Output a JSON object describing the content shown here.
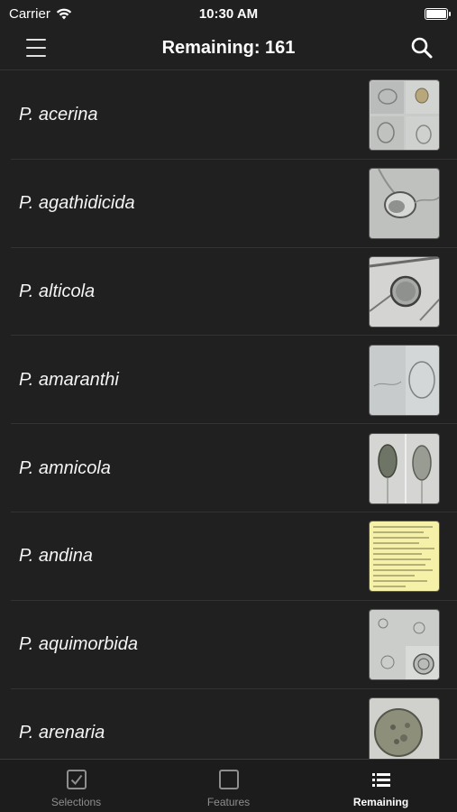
{
  "status_bar": {
    "carrier": "Carrier",
    "time": "10:30 AM"
  },
  "nav": {
    "title": "Remaining: 161"
  },
  "species": [
    {
      "label": "P. acerina"
    },
    {
      "label": "P. agathidicida"
    },
    {
      "label": "P. alticola"
    },
    {
      "label": "P. amaranthi"
    },
    {
      "label": "P. amnicola"
    },
    {
      "label": "P. andina"
    },
    {
      "label": "P. aquimorbida"
    },
    {
      "label": "P. arenaria"
    }
  ],
  "tabs": [
    {
      "label": "Selections",
      "icon": "checkbox-icon"
    },
    {
      "label": "Features",
      "icon": "square-icon"
    },
    {
      "label": "Remaining",
      "icon": "list-icon",
      "active": true
    }
  ],
  "colors": {
    "background": "#202020",
    "divider": "#333333",
    "tab_inactive": "#8e8e8e"
  }
}
